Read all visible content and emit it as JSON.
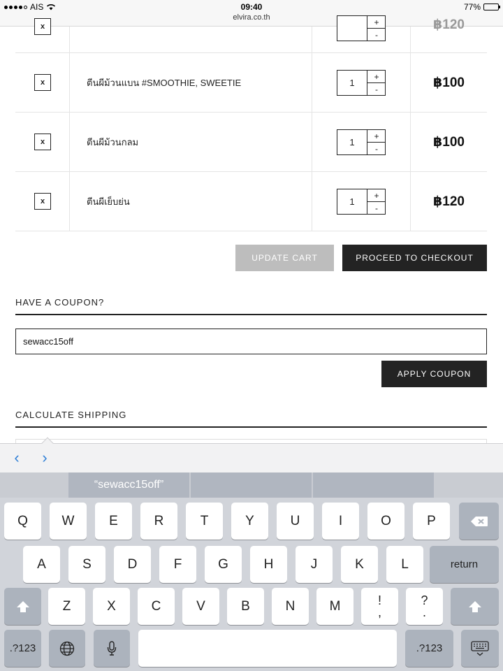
{
  "status_bar": {
    "carrier": "AIS",
    "time": "09:40",
    "url": "elvira.co.th",
    "battery": "77%",
    "battery_level": 0.77
  },
  "cart": {
    "rows": [
      {
        "remove": "x",
        "name": "",
        "qty": "",
        "plus": "+",
        "minus": "-",
        "price": "฿120"
      },
      {
        "remove": "x",
        "name": "ตีนผีม้วนแบน #SMOOTHIE, SWEETIE",
        "qty": "1",
        "plus": "+",
        "minus": "-",
        "price": "฿100"
      },
      {
        "remove": "x",
        "name": "ตีนผีม้วนกลม",
        "qty": "1",
        "plus": "+",
        "minus": "-",
        "price": "฿100"
      },
      {
        "remove": "x",
        "name": "ตีนผีเย็บย่น",
        "qty": "1",
        "plus": "+",
        "minus": "-",
        "price": "฿120"
      }
    ],
    "update_label": "UPDATE CART",
    "checkout_label": "PROCEED TO CHECKOUT"
  },
  "coupon": {
    "title": "HAVE A COUPON?",
    "value": "sewacc15off",
    "apply_label": "APPLY COUPON"
  },
  "shipping": {
    "title": "CALCULATE SHIPPING"
  },
  "accessory": {
    "prev": "‹",
    "next": "›"
  },
  "suggestions": [
    "“sewacc15off”",
    "",
    ""
  ],
  "keyboard": {
    "row1": [
      "Q",
      "W",
      "E",
      "R",
      "T",
      "Y",
      "U",
      "I",
      "O",
      "P"
    ],
    "row2": [
      "A",
      "S",
      "D",
      "F",
      "G",
      "H",
      "J",
      "K",
      "L"
    ],
    "row3": [
      "Z",
      "X",
      "C",
      "V",
      "B",
      "N",
      "M"
    ],
    "return_label": "return",
    "numbers_label": ".?123",
    "punct1_top": "!",
    "punct1_bottom": ",",
    "punct2_top": "?",
    "punct2_bottom": "."
  },
  "colors": {
    "accent": "#2f7fd6",
    "dark_button": "#232323",
    "disabled_button": "#bdbdbd",
    "keyboard_bg": "#d1d4da"
  }
}
